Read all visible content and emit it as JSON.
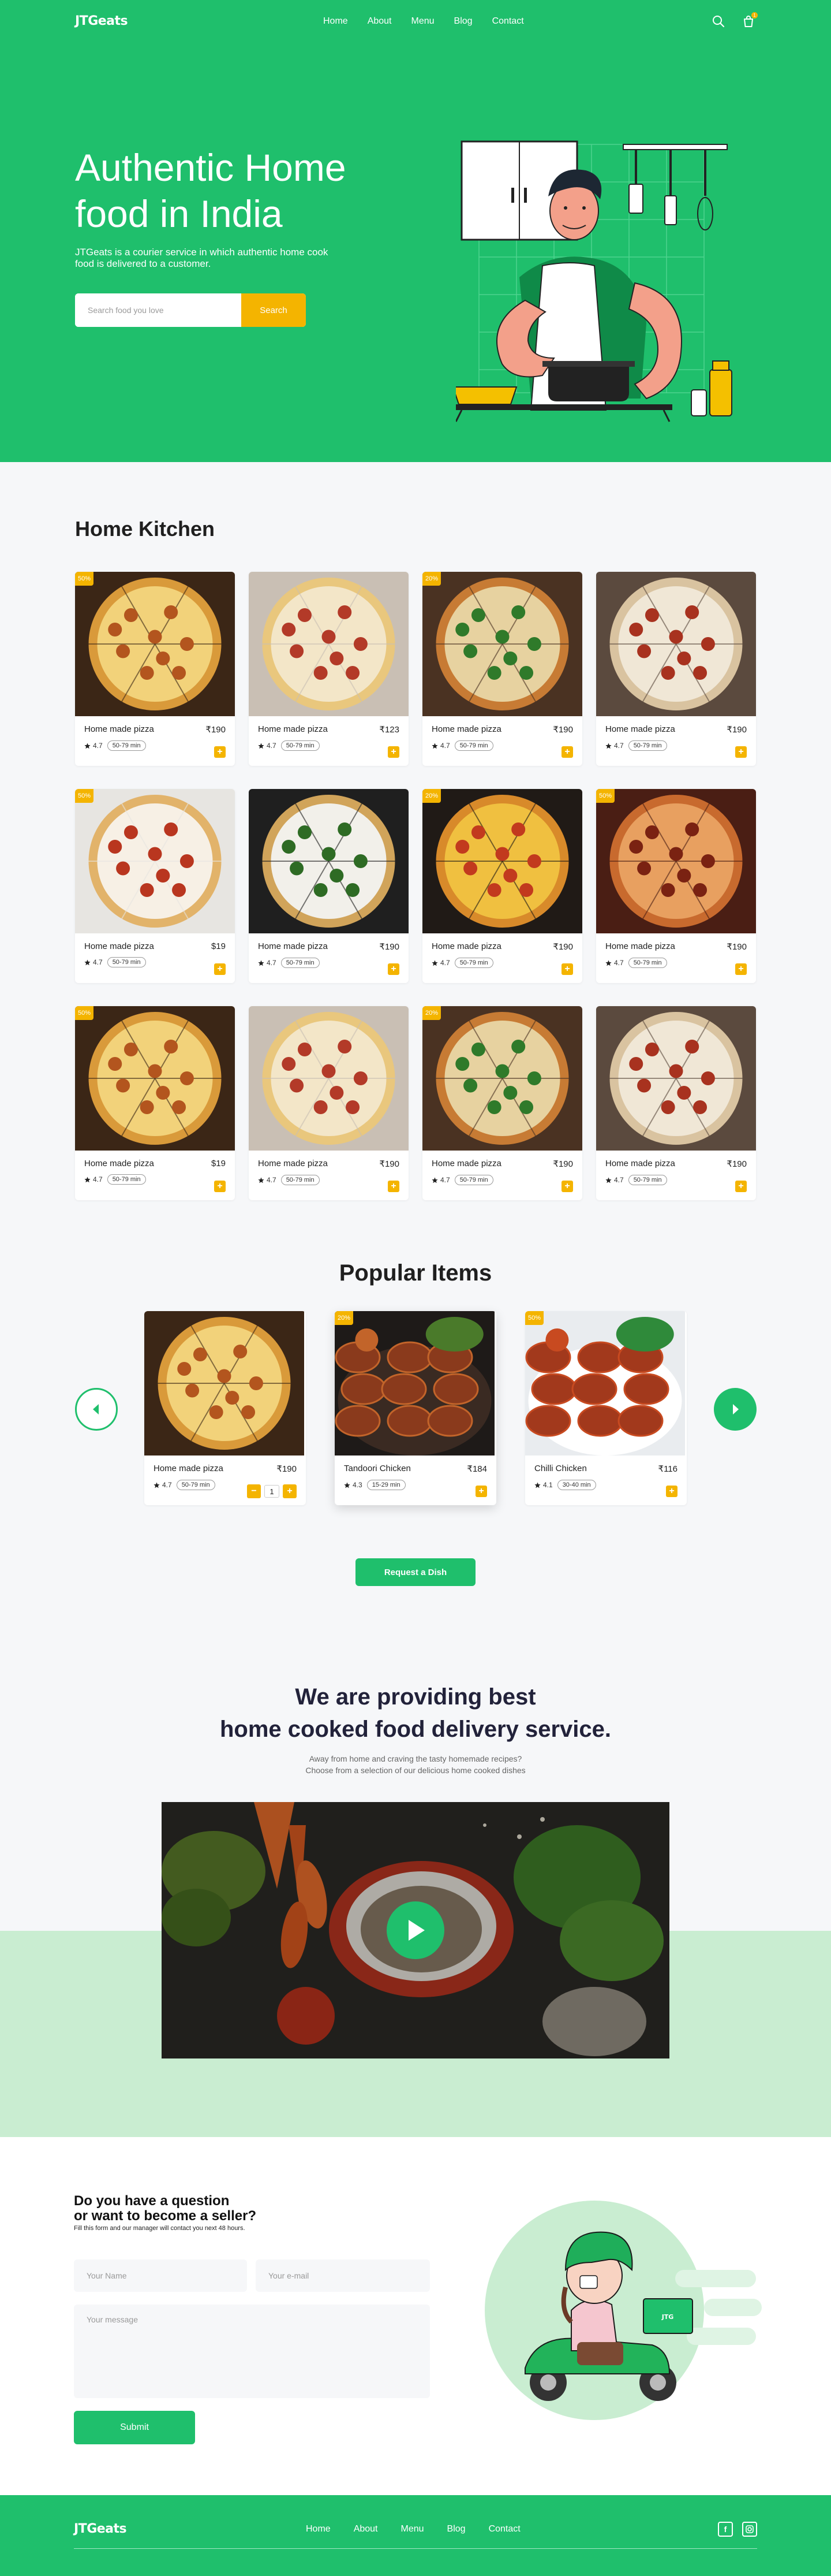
{
  "header": {
    "logo": "JTGeats",
    "nav": [
      "Home",
      "About",
      "Menu",
      "Blog",
      "Contact"
    ],
    "icons": [
      "search-icon",
      "cart-icon"
    ],
    "cart_badge": "1"
  },
  "hero": {
    "title": "Authentic Home food in India",
    "subtitle": "JTGeats is a courier service in which authentic home cook food is delivered to a customer.",
    "search_placeholder": "Search food you love",
    "search_button": "Search"
  },
  "kitchen": {
    "title": "Home Kitchen",
    "items": [
      {
        "name": "Home made pizza",
        "price": "₹190",
        "rating": "4.7",
        "time": "50-79 min",
        "badge": "50%",
        "img": "pizza-board"
      },
      {
        "name": "Home made pizza",
        "price": "₹123",
        "rating": "4.7",
        "time": "50-79 min",
        "badge": "",
        "img": "pizza-slice"
      },
      {
        "name": "Home made pizza",
        "price": "₹190",
        "rating": "4.7",
        "time": "50-79 min",
        "badge": "20%",
        "img": "pizza-basil"
      },
      {
        "name": "Home made pizza",
        "price": "₹190",
        "rating": "4.7",
        "time": "50-79 min",
        "badge": "",
        "img": "pizza-salami"
      },
      {
        "name": "Home made pizza",
        "price": "$19",
        "rating": "4.7",
        "time": "50-79 min",
        "badge": "50%",
        "img": "pizza-box"
      },
      {
        "name": "Home made pizza",
        "price": "₹190",
        "rating": "4.7",
        "time": "50-79 min",
        "badge": "",
        "img": "pizza-spinach"
      },
      {
        "name": "Home made pizza",
        "price": "₹190",
        "rating": "4.7",
        "time": "50-79 min",
        "badge": "20%",
        "img": "pizza-spread"
      },
      {
        "name": "Home made pizza",
        "price": "₹190",
        "rating": "4.7",
        "time": "50-79 min",
        "badge": "50%",
        "img": "pizza-bbq"
      },
      {
        "name": "Home made pizza",
        "price": "$19",
        "rating": "4.7",
        "time": "50-79 min",
        "badge": "50%",
        "img": "pizza-board"
      },
      {
        "name": "Home made pizza",
        "price": "₹190",
        "rating": "4.7",
        "time": "50-79 min",
        "badge": "",
        "img": "pizza-slice"
      },
      {
        "name": "Home made pizza",
        "price": "₹190",
        "rating": "4.7",
        "time": "50-79 min",
        "badge": "20%",
        "img": "pizza-basil"
      },
      {
        "name": "Home made pizza",
        "price": "₹190",
        "rating": "4.7",
        "time": "50-79 min",
        "badge": "",
        "img": "pizza-salami"
      }
    ]
  },
  "popular": {
    "title": "Popular Items",
    "items": [
      {
        "name": "Home made pizza",
        "price": "₹190",
        "rating": "4.7",
        "time": "50-79 min",
        "badge": "",
        "img": "pizza-board",
        "qty": "1"
      },
      {
        "name": "Tandoori Chicken",
        "price": "₹184",
        "rating": "4.3",
        "time": "15-29 min",
        "badge": "20%",
        "img": "chicken-tandoori"
      },
      {
        "name": "Chilli Chicken",
        "price": "₹116",
        "rating": "4.1",
        "time": "30-40 min",
        "badge": "50%",
        "img": "chicken-chilli"
      }
    ],
    "request_button": "Request a Dish"
  },
  "providing": {
    "title_line1": "We are providing best",
    "title_line2": "home cooked food delivery service.",
    "sub_line1": "Away from home and craving the tasty homemade recipes?",
    "sub_line2": "Choose from a selection of our delicious home cooked dishes"
  },
  "contact": {
    "title_line1": "Do you have a question",
    "title_line2": "or want to become a seller?",
    "subtitle": "Fill this form and our manager will contact you next 48 hours.",
    "name_placeholder": "Your Name",
    "email_placeholder": "Your e-mail",
    "message_placeholder": "Your message",
    "submit": "Submit"
  },
  "footer": {
    "logo": "JTGeats",
    "nav": [
      "Home",
      "About",
      "Menu",
      "Blog",
      "Contact"
    ],
    "social": [
      "facebook-icon",
      "instagram-icon"
    ]
  },
  "colors": {
    "brand_green": "#1fbf6c",
    "accent_yellow": "#f4b400",
    "light_green": "#c9edd1",
    "section_gray": "#f6f7f9"
  }
}
